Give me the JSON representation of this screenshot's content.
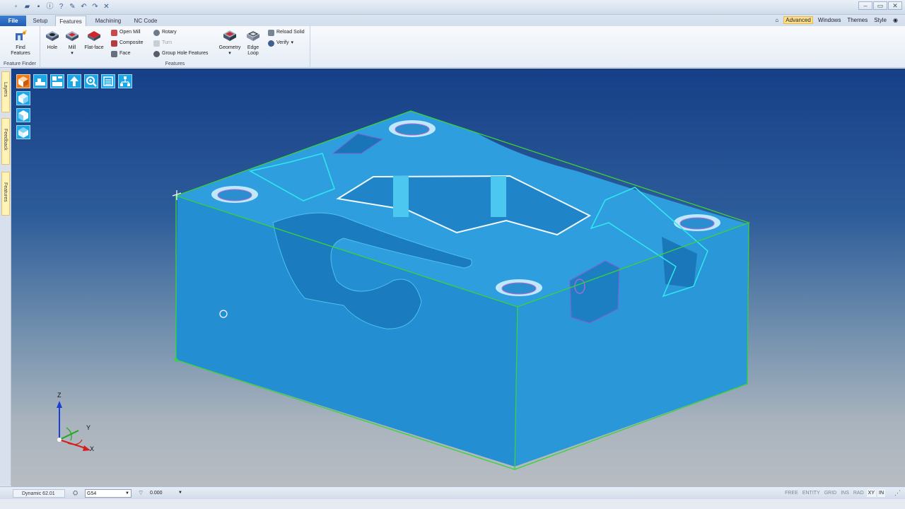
{
  "ribbon_tabs": [
    "File",
    "Setup",
    "Features",
    "Machining",
    "NC Code"
  ],
  "active_tab": "Features",
  "right_menu": {
    "advanced": "Advanced",
    "windows": "Windows",
    "themes": "Themes",
    "style": "Style"
  },
  "feature_finder": {
    "find_label_1": "Find",
    "find_label_2": "Features",
    "group_label": "Feature Finder"
  },
  "features_group": {
    "hole": "Hole",
    "mill": "Mill",
    "flat_face": "Flat-face",
    "open_mill": "Open Mill",
    "composite": "Composite",
    "face": "Face",
    "rotary": "Rotary",
    "turn": "Turn",
    "group_hole": "Group Hole Features",
    "geometry": "Geometry",
    "edge_loop_1": "Edge",
    "edge_loop_2": "Loop",
    "reload_solid": "Reload Solid",
    "verify": "Verify",
    "group_label": "Features"
  },
  "side_tabs": [
    "Layers",
    "Feedback",
    "Features"
  ],
  "axes": {
    "z": "Z",
    "y": "Y",
    "x": "X"
  },
  "status": {
    "dynamic": "Dynamic 62.01",
    "coord_system": "G54",
    "value": "0.000",
    "flags": [
      "FREE",
      "ENTITY",
      "GRID",
      "INS",
      "RAD",
      "XY",
      "IN"
    ],
    "active_flags": [
      "XY",
      "IN"
    ]
  },
  "colors": {
    "part": "#2396d6",
    "bbox": "#39d33a",
    "feature": "#2ee8f0",
    "accent": "#1f5db4"
  }
}
